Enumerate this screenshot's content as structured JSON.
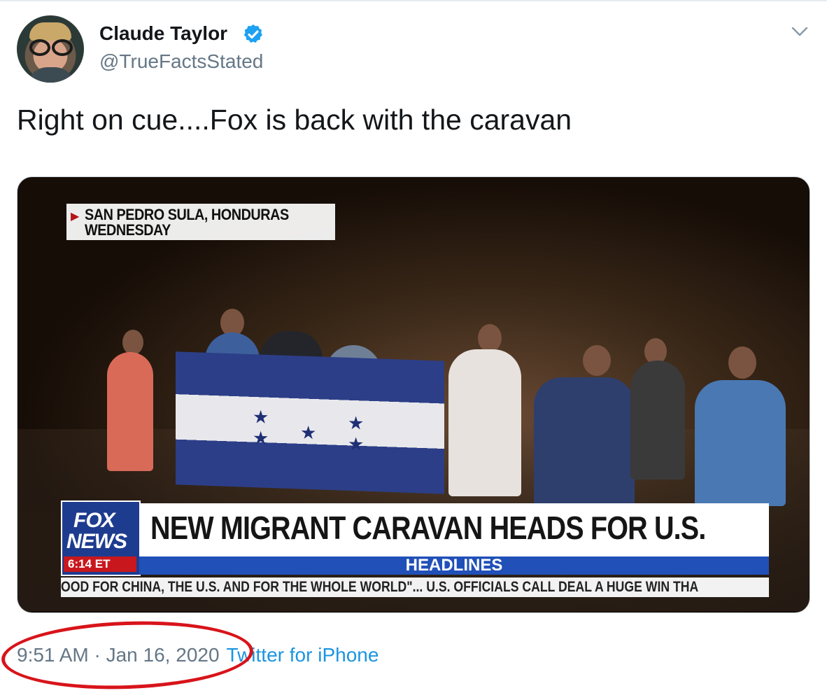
{
  "tweet": {
    "author_name": "Claude Taylor",
    "handle": "@TrueFactsStated",
    "text": "Right on cue....Fox is back with the caravan",
    "timestamp": "9:51 AM · Jan 16, 2020",
    "source": "Twitter for iPhone",
    "verified_icon": "verified-badge-icon",
    "menu_icon": "chevron-down-icon"
  },
  "media": {
    "location_line1": "SAN PEDRO SULA, HONDURAS",
    "location_line2": "WEDNESDAY",
    "logo_line1": "FOX",
    "logo_line2": "NEWS",
    "logo_time": "6:14 ET",
    "headline": "NEW MIGRANT CARAVAN HEADS FOR U.S.",
    "subheadline": "HEADLINES",
    "ticker": "OOD FOR CHINA, THE U.S. AND FOR THE WHOLE WORLD\"...   U.S. OFFICIALS CALL DEAL A HUGE WIN THA"
  },
  "colors": {
    "verified": "#1da1f2",
    "link": "#1b95e0",
    "annotation": "#d8141a",
    "fox_blue": "#1e3c8f"
  }
}
